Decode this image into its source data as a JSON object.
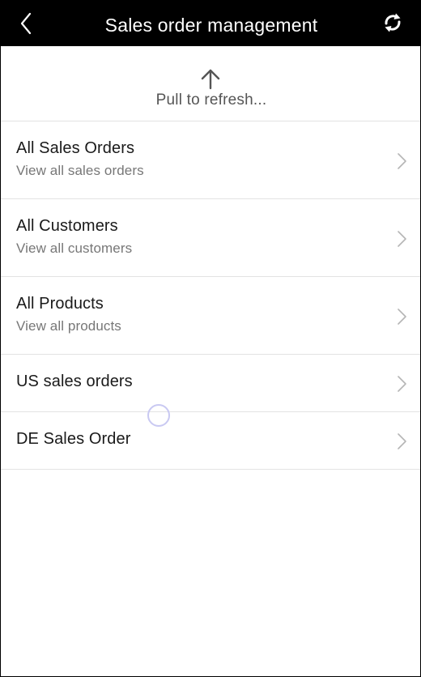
{
  "header": {
    "title": "Sales order management",
    "back_icon": "chevron-left-icon",
    "sync_icon": "sync-icon"
  },
  "pull_to_refresh": {
    "icon": "arrow-up-icon",
    "text": "Pull to refresh..."
  },
  "rows": [
    {
      "title": "All Sales Orders",
      "subtitle": "View all sales orders"
    },
    {
      "title": "All Customers",
      "subtitle": "View all customers"
    },
    {
      "title": "All Products",
      "subtitle": "View all products"
    },
    {
      "title": "US sales orders"
    },
    {
      "title": "DE Sales Order"
    }
  ],
  "colors": {
    "header_bg": "#000000",
    "header_text": "#ffffff",
    "divider": "#e3e3e3",
    "subtitle": "#777777",
    "chevron": "#b5b5b5"
  }
}
